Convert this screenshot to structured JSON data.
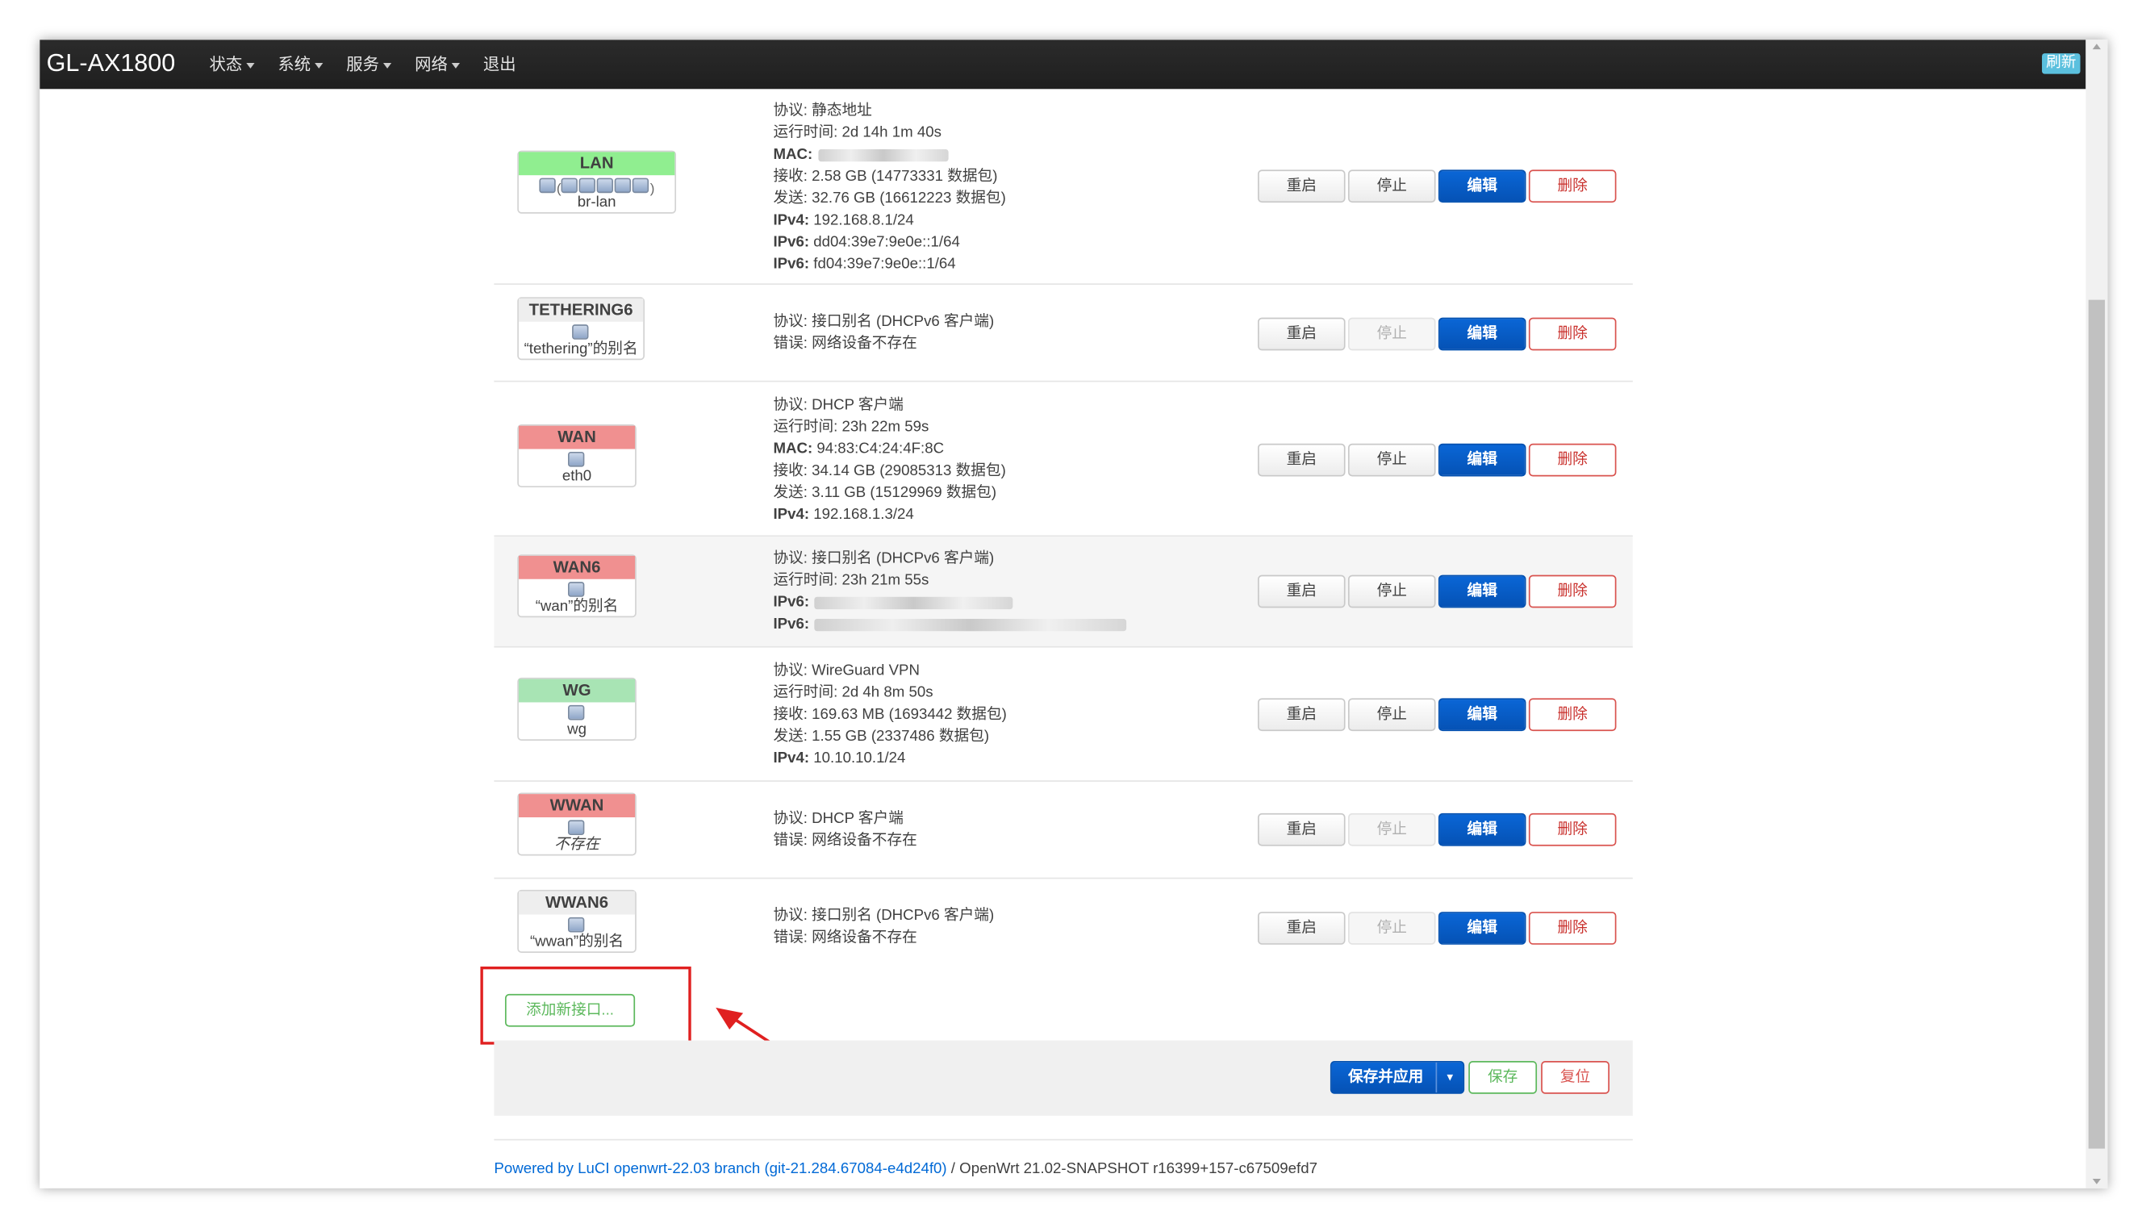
{
  "header": {
    "brand": "GL-AX1800",
    "menu": [
      {
        "label": "状态"
      },
      {
        "label": "系统"
      },
      {
        "label": "服务"
      },
      {
        "label": "网络"
      },
      {
        "label": "退出"
      }
    ],
    "refresh_label": "刷新"
  },
  "interfaces": [
    {
      "name": "LAN",
      "name_color": "#90ee90",
      "device": "br-lan",
      "device_prefix": "(",
      "device_suffix": ")",
      "lines": [
        {
          "label": "协议:",
          "value": " 静态地址",
          "bold": false
        },
        {
          "label": "运行时间:",
          "value": " 2d 14h 1m 40s",
          "bold": false
        },
        {
          "label": "MAC:",
          "value": "",
          "bold": true
        },
        {
          "label": "接收:",
          "value": " 2.58 GB (14773331 数据包)",
          "bold": false
        },
        {
          "label": "发送:",
          "value": " 32.76 GB (16612223 数据包)",
          "bold": false
        },
        {
          "label": "IPv4:",
          "value": " 192.168.8.1/24",
          "bold": true
        },
        {
          "label": "IPv6:",
          "value": " dd04:39e7:9e0e::1/64",
          "bold": true
        },
        {
          "label": "IPv6:",
          "value": " fd04:39e7:9e0e::1/64",
          "bold": true
        }
      ]
    },
    {
      "name": "TETHERING6",
      "name_color": "#eeeeee",
      "device": "“tethering”的别名",
      "lines": [
        {
          "label": "协议:",
          "value": " 接口别名 (DHCPv6 客户端)",
          "bold": false
        },
        {
          "label": "错误:",
          "value": " 网络设备不存在",
          "bold": false
        }
      ]
    },
    {
      "name": "WAN",
      "name_color": "#f09090",
      "device": "eth0",
      "lines": [
        {
          "label": "协议:",
          "value": " DHCP 客户端",
          "bold": false
        },
        {
          "label": "运行时间:",
          "value": " 23h 22m 59s",
          "bold": false
        },
        {
          "label": "MAC:",
          "value": " 94:83:C4:24:4F:8C",
          "bold": true
        },
        {
          "label": "接收:",
          "value": " 34.14 GB (29085313 数据包)",
          "bold": false
        },
        {
          "label": "发送:",
          "value": " 3.11 GB (15129969 数据包)",
          "bold": false
        },
        {
          "label": "IPv4:",
          "value": " 192.168.1.3/24",
          "bold": true
        }
      ]
    },
    {
      "name": "WAN6",
      "name_color": "#f09090",
      "device": "“wan”的别名",
      "lines": [
        {
          "label": "协议:",
          "value": " 接口别名 (DHCPv6 客户端)",
          "bold": false
        },
        {
          "label": "运行时间:",
          "value": " 23h 21m 55s",
          "bold": false
        },
        {
          "label": "IPv6:",
          "value": "",
          "bold": true
        },
        {
          "label": "IPv6:",
          "value": "",
          "bold": true
        }
      ]
    },
    {
      "name": "WG",
      "name_color": "#a8e4b4",
      "device": "wg",
      "lines": [
        {
          "label": "协议:",
          "value": " WireGuard VPN",
          "bold": false
        },
        {
          "label": "运行时间:",
          "value": " 2d 4h 8m 50s",
          "bold": false
        },
        {
          "label": "接收:",
          "value": " 169.63 MB (1693442 数据包)",
          "bold": false
        },
        {
          "label": "发送:",
          "value": " 1.55 GB (2337486 数据包)",
          "bold": false
        },
        {
          "label": "IPv4:",
          "value": " 10.10.10.1/24",
          "bold": true
        }
      ]
    },
    {
      "name": "WWAN",
      "name_color": "#f09090",
      "device": "不存在",
      "lines": [
        {
          "label": "协议:",
          "value": " DHCP 客户端",
          "bold": false
        },
        {
          "label": "错误:",
          "value": " 网络设备不存在",
          "bold": false
        }
      ]
    },
    {
      "name": "WWAN6",
      "name_color": "#eeeeee",
      "device": "“wwan”的别名",
      "lines": [
        {
          "label": "协议:",
          "value": " 接口别名 (DHCPv6 客户端)",
          "bold": false
        },
        {
          "label": "错误:",
          "value": " 网络设备不存在",
          "bold": false
        }
      ]
    }
  ],
  "actions": {
    "restart": "重启",
    "stop": "停止",
    "edit": "编辑",
    "delete": "删除"
  },
  "add_interface_label": "添加新接口...",
  "form_actions": {
    "save_apply": "保存并应用",
    "save": "保存",
    "reset": "复位"
  },
  "footer": {
    "luci_link": "Powered by LuCI openwrt-22.03 branch (git-21.284.67084-e4d24f0)",
    "separator": " / ",
    "version": "OpenWrt 21.02-SNAPSHOT r16399+157-c67509efd7"
  },
  "colors": {
    "primary": "#0552b5",
    "danger": "#d9534f",
    "success": "#5cb85c",
    "highlight": "#e02020"
  }
}
